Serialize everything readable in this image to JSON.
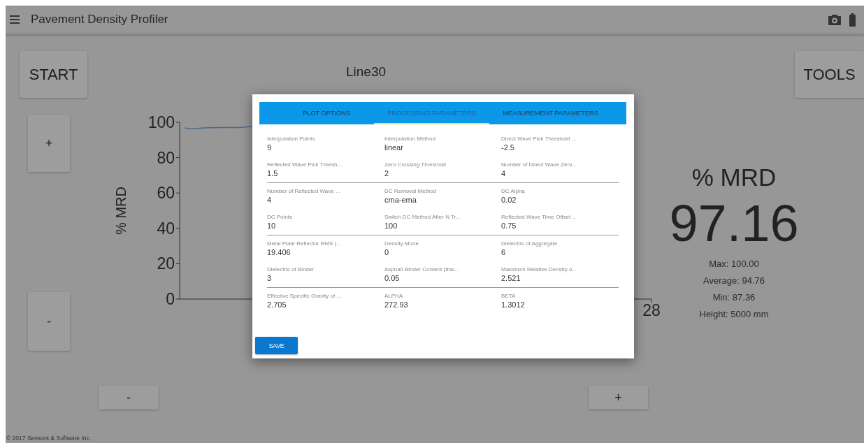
{
  "app_bar": {
    "title": "Pavement Density Profiler"
  },
  "buttons": [
    {
      "kind": "start",
      "label": "START"
    },
    {
      "kind": "tools",
      "label": "TOOLS"
    },
    {
      "kind": "zoom_in",
      "label": "+"
    },
    {
      "kind": "zoom_out",
      "label": "-"
    },
    {
      "kind": "pan_left",
      "label": "-"
    },
    {
      "kind": "pan_right",
      "label": "+"
    }
  ],
  "plot": {
    "title": "Line30",
    "y_axis_title": "% MRD",
    "y_tick_labels": [
      "100",
      "80",
      "60",
      "40",
      "20",
      "0"
    ],
    "x_tick_labels": [
      "28"
    ]
  },
  "readout": {
    "heading": "% MRD",
    "value": "97.16",
    "stats": [
      "Max: 100.00",
      "Average: 94.76",
      "Min: 87.36",
      "Height: 5000 mm"
    ]
  },
  "dialog": {
    "tabs": [
      {
        "label": "PLOT OPTIONS",
        "selected": false
      },
      {
        "label": "PROCESSING PARAMETERS",
        "selected": true
      },
      {
        "label": "MEASUREMENT PARAMETERS",
        "selected": false
      }
    ],
    "groups": [
      [
        {
          "label": "Interpolation Points",
          "value": "9"
        },
        {
          "label": "Interpolation Method",
          "value": "linear"
        },
        {
          "label": "Direct Wave Pick Threshold ...",
          "value": "-2.5"
        },
        {
          "label": "Reflected Wave Pick Thresh...",
          "value": "1.5"
        },
        {
          "label": "Zero Crossing Threshold",
          "value": "2"
        },
        {
          "label": "Number of Direct Wave Zero...",
          "value": "4"
        }
      ],
      [
        {
          "label": "Number of Reflected Wave ...",
          "value": "4"
        },
        {
          "label": "DC Removal Method",
          "value": "cma-ema"
        },
        {
          "label": "DC Alpha",
          "value": "0.02"
        },
        {
          "label": "DC Points",
          "value": "10"
        },
        {
          "label": "Switch DC Method After N Tr...",
          "value": "100"
        },
        {
          "label": "Reflected Wave Time Offset ...",
          "value": "0.75"
        }
      ],
      [
        {
          "label": "Metal Plate Reflector RMS (...",
          "value": "19.406"
        },
        {
          "label": "Density Mode",
          "value": "0"
        },
        {
          "label": "Dielectric of Aggregate",
          "value": "6"
        },
        {
          "label": "Dielectric of Binder",
          "value": "3"
        },
        {
          "label": "Asphalt Binder Content (frac...",
          "value": "0.05"
        },
        {
          "label": "Maximum Relative Density o...",
          "value": "2.521"
        }
      ],
      [
        {
          "label": "Effective Specific Gravity of ...",
          "value": "2.705"
        },
        {
          "label": "ALPHA",
          "value": "272.93"
        },
        {
          "label": "BETA",
          "value": "1.3012"
        }
      ]
    ],
    "save": "SAVE"
  },
  "footer": "© 2017 Sensors & Software Inc."
}
